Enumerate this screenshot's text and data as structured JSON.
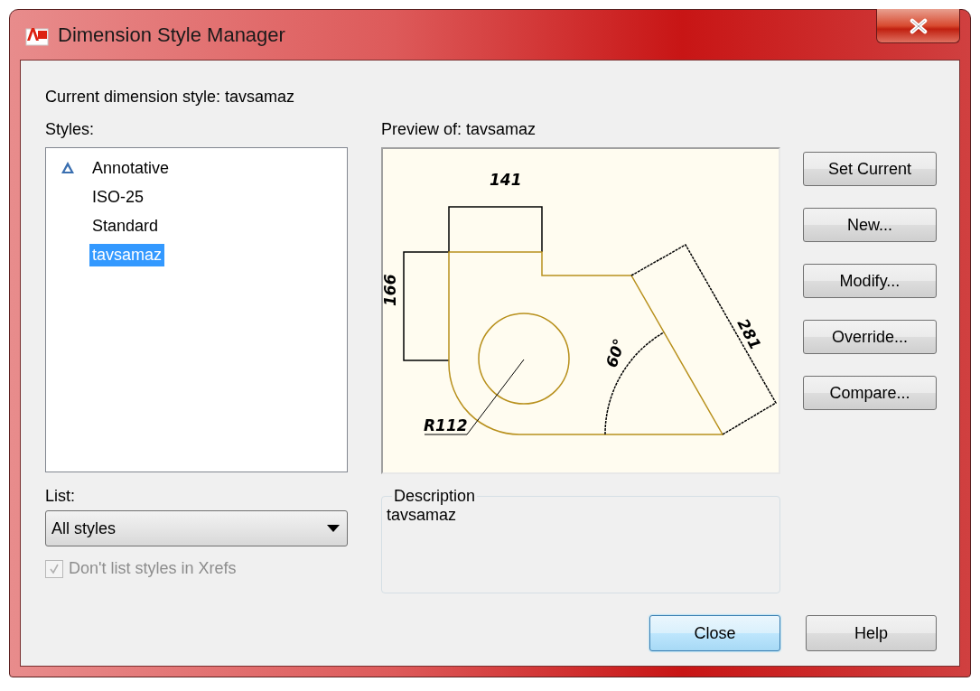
{
  "window": {
    "title": "Dimension Style Manager"
  },
  "current_style": "Current dimension style: tavsamaz",
  "styles": {
    "label": "Styles:",
    "items": [
      {
        "name": "Annotative",
        "annotative": true,
        "selected": false
      },
      {
        "name": "ISO-25",
        "annotative": false,
        "selected": false
      },
      {
        "name": "Standard",
        "annotative": false,
        "selected": false
      },
      {
        "name": "tavsamaz",
        "annotative": false,
        "selected": true
      }
    ]
  },
  "list": {
    "label": "List:",
    "value": "All styles"
  },
  "xref_checkbox": {
    "label": "Don't list styles in Xrefs",
    "checked": true,
    "disabled": true
  },
  "preview": {
    "label": "Preview of: tavsamaz",
    "dimension_labels": [
      "141",
      "166",
      "281",
      "60°",
      "R112"
    ]
  },
  "description": {
    "legend": "Description",
    "text": "tavsamaz"
  },
  "side_buttons": [
    "Set Current",
    "New...",
    "Modify...",
    "Override...",
    "Compare..."
  ],
  "footer_buttons": [
    {
      "label": "Close",
      "default": true
    },
    {
      "label": "Help",
      "default": false
    }
  ]
}
